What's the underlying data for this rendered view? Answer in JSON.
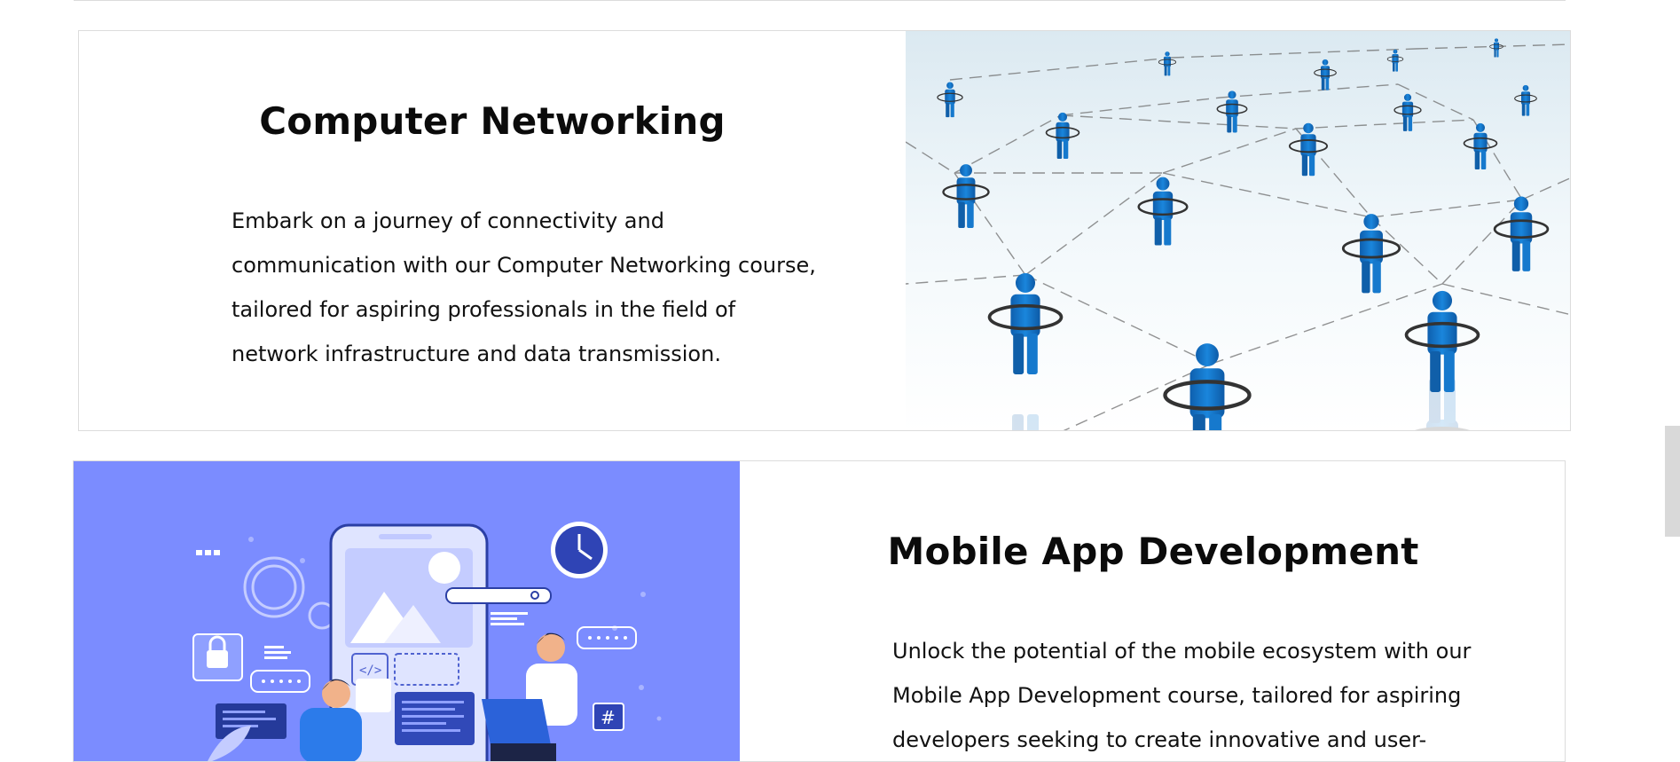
{
  "courses": [
    {
      "title": "Computer Networking",
      "description": "Embark on a journey of connectivity and communication with our Computer Networking course, tailored for aspiring professionals in the field of network infrastructure and data transmission.",
      "image_icon": "network-people-icon"
    },
    {
      "title": "Mobile App Development",
      "description": "Unlock the potential of the mobile ecosystem with our Mobile App Development course, tailored for aspiring developers seeking to create innovative and user-",
      "image_icon": "mobile-app-illustration-icon"
    }
  ],
  "colors": {
    "network_figure": "#1470c4",
    "mobile_bg": "#7b8cff",
    "title": "#0b0b0b",
    "border": "#dcdcdc"
  }
}
